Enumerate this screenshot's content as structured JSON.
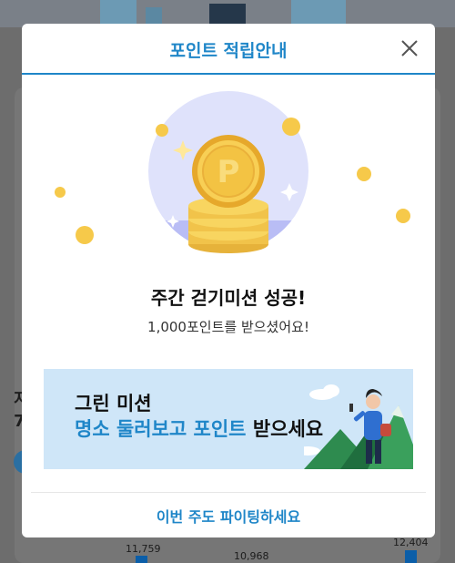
{
  "background": {
    "side_text_1": "지",
    "side_text_2": "7",
    "chart_values": [
      "11,759",
      "10,968",
      "12,404"
    ]
  },
  "modal": {
    "title": "포인트 적립안내",
    "close_icon": "close-icon",
    "illustration_icon": "point-coins-icon",
    "headline": "주간 걷기미션 성공!",
    "subline": "1,000포인트를 받으셨어요!",
    "banner": {
      "line1": "그린 미션",
      "line2_accent": "명소 둘러보고 포인트",
      "line2_plain": " 받으세요",
      "art_icon": "hiker-illustration"
    },
    "footer_link": "이번 주도 파이팅하세요"
  },
  "colors": {
    "accent": "#1f86c8",
    "banner_bg": "#cfe6f8",
    "coin": "#f6c94a",
    "circle_bg": "#dfe2fb"
  }
}
